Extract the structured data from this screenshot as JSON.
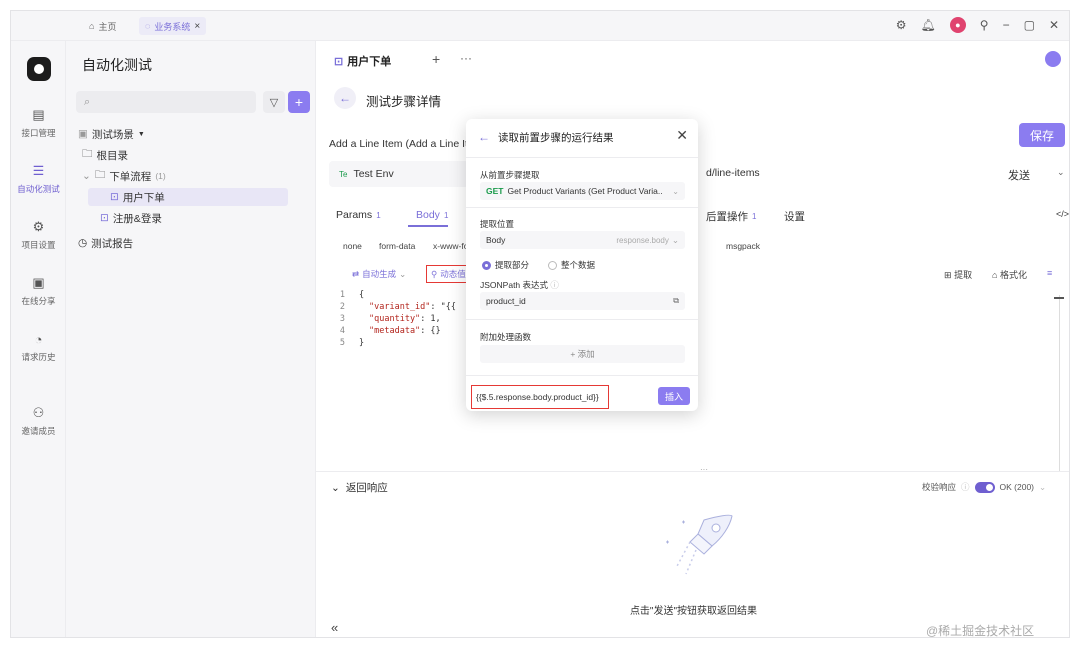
{
  "titlebar": {
    "tabs": [
      {
        "label": "主页"
      },
      {
        "label": "业务系统"
      }
    ],
    "close_glyph": "×"
  },
  "rail": {
    "items": [
      {
        "label": "接口管理",
        "icon": "api-icon"
      },
      {
        "label": "自动化测试",
        "icon": "stack-icon"
      },
      {
        "label": "项目设置",
        "icon": "settings-icon"
      },
      {
        "label": "在线分享",
        "icon": "share-icon"
      },
      {
        "label": "请求历史",
        "icon": "history-icon"
      },
      {
        "label": "邀请成员",
        "icon": "invite-icon"
      }
    ]
  },
  "tree": {
    "title": "自动化测试",
    "section": "测试场景",
    "root": "根目录",
    "folder": "下单流程",
    "folder_count": "(1)",
    "case_active": "用户下单",
    "case_other": "注册&登录",
    "report": "测试报告"
  },
  "main": {
    "tab_label": "用户下单",
    "detail_title": "测试步骤详情",
    "step_name": "Add a Line Item (Add a Line Ite",
    "save": "保存",
    "env": "Test Env",
    "env_badge": "Te",
    "url": "d/line-items",
    "send": "发送",
    "tabs": [
      {
        "label": "Params",
        "badge": "1"
      },
      {
        "label": "Body",
        "badge": "1"
      },
      {
        "label": "后置操作",
        "badge": "1"
      },
      {
        "label": "设置",
        "badge": ""
      }
    ],
    "code_toggle": "</>",
    "body_types": [
      "none",
      "form-data",
      "x-www-for",
      "msgpack"
    ],
    "tool_auto": "自动生成",
    "tool_dynamic": "动态值",
    "tool_extract": "提取",
    "tool_format": "格式化",
    "code_lines": [
      {
        "n": "1",
        "text": "{"
      },
      {
        "n": "2",
        "key": "\"variant_id\"",
        "rest": ": \"{{"
      },
      {
        "n": "3",
        "key": "\"quantity\"",
        "rest": ": 1,"
      },
      {
        "n": "4",
        "key": "\"metadata\"",
        "rest": ": {}"
      },
      {
        "n": "5",
        "text": "}"
      }
    ]
  },
  "response": {
    "title": "返回响应",
    "verify": "校验响应",
    "status": "OK (200)",
    "hint": "点击\"发送\"按钮获取返回结果",
    "collapse": "«",
    "watermark": "@稀土掘金技术社区"
  },
  "popover": {
    "title": "读取前置步骤的运行结果",
    "from_label": "从前置步骤提取",
    "method": "GET",
    "from_value": "Get Product Variants (Get Product Varia...",
    "pos_label": "提取位置",
    "pos_value": "Body",
    "pos_hint": "response.body",
    "radio_part": "提取部分",
    "radio_all": "整个数据",
    "jsonpath_label": "JSONPath 表达式",
    "jsonpath_value": "product_id",
    "fn_label": "附加处理函数",
    "fn_add": "+ 添加",
    "expression": "{{$.5.response.body.product_id}}",
    "insert": "插入"
  },
  "colors": {
    "accent": "#8b7cf0",
    "highlight_box": "#e53935",
    "get_method": "#1a9b4b"
  }
}
